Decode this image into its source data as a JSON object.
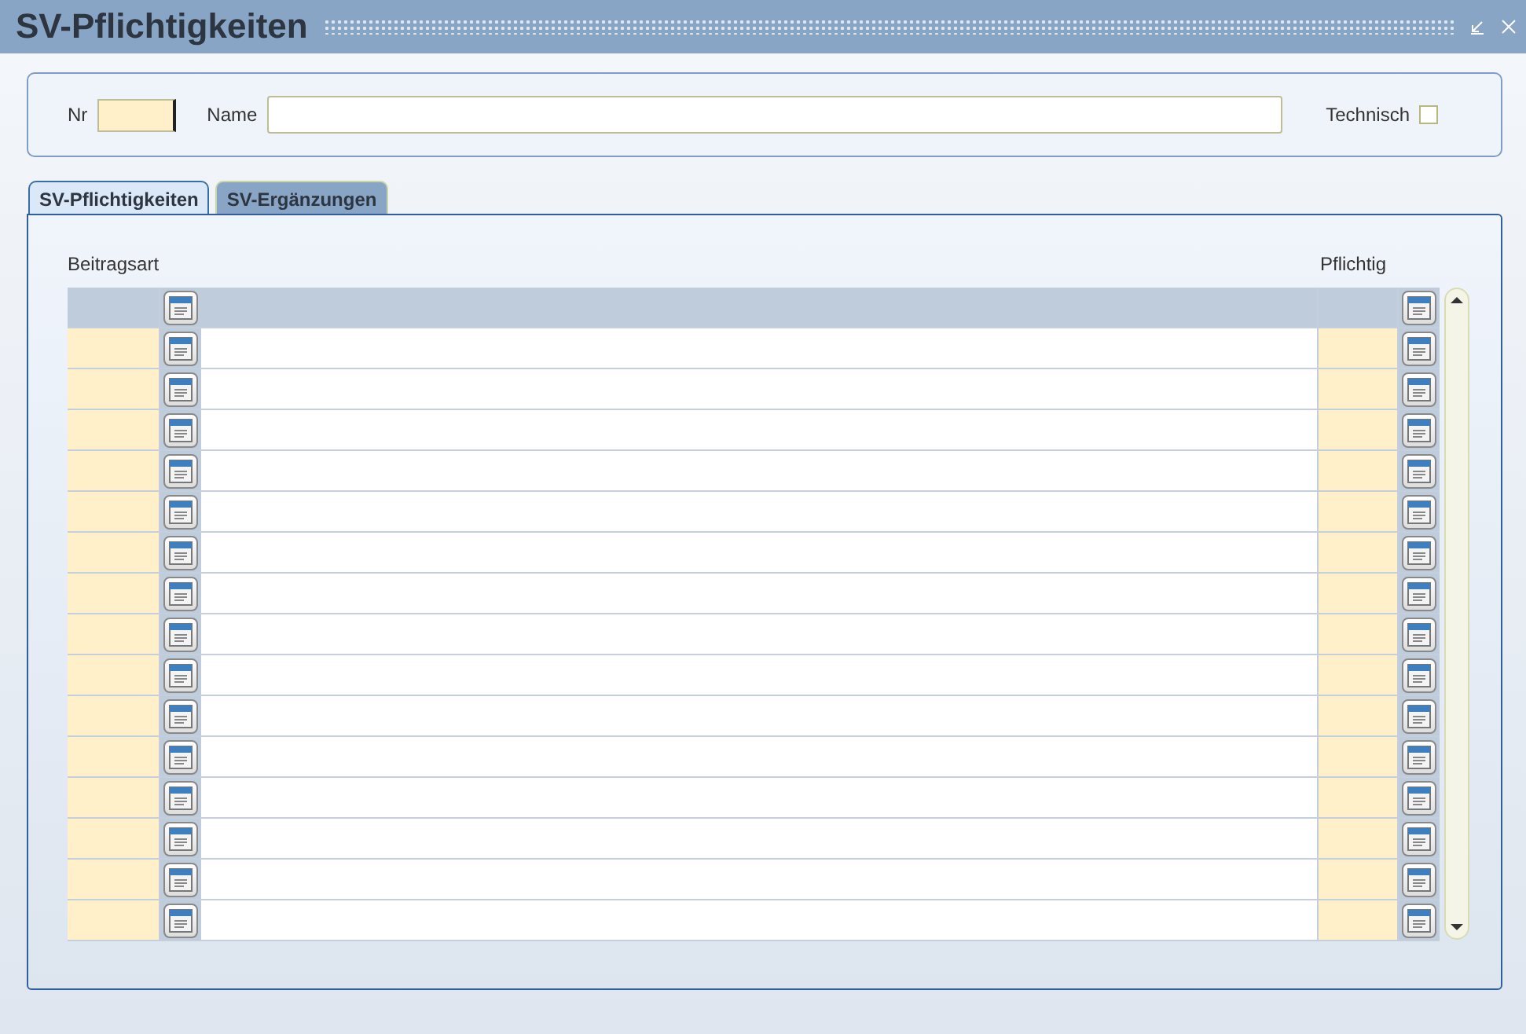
{
  "window": {
    "title": "SV-Pflichtigkeiten"
  },
  "header": {
    "nr_label": "Nr",
    "name_label": "Name",
    "technisch_label": "Technisch",
    "technisch_checked": false
  },
  "tabs": [
    {
      "label": "SV-Pflichtigkeiten",
      "selected": true
    },
    {
      "label": "SV-Ergänzungen",
      "selected": false
    }
  ],
  "table": {
    "columns": [
      "Beitragsart",
      "Pflichtig"
    ],
    "rows": [
      {
        "selected": true
      },
      {
        "selected": false
      },
      {
        "selected": false
      },
      {
        "selected": false
      },
      {
        "selected": false
      },
      {
        "selected": false
      },
      {
        "selected": false
      },
      {
        "selected": false
      },
      {
        "selected": false
      },
      {
        "selected": false
      },
      {
        "selected": false
      },
      {
        "selected": false
      },
      {
        "selected": false
      },
      {
        "selected": false
      },
      {
        "selected": false
      },
      {
        "selected": false
      }
    ]
  }
}
